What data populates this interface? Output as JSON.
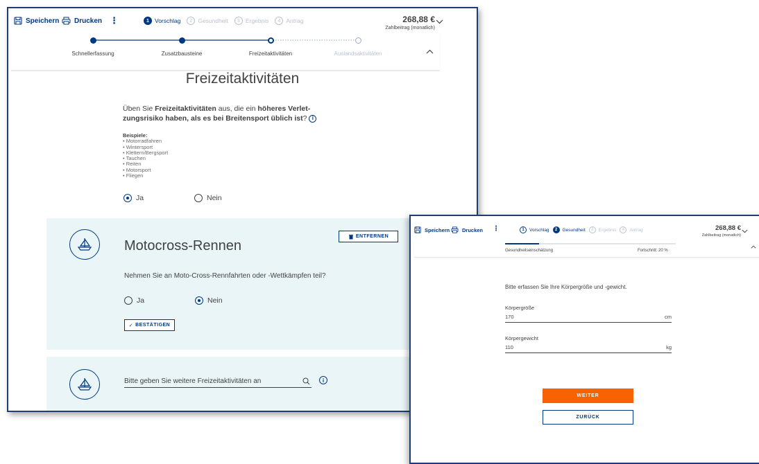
{
  "window1": {
    "toolbar": {
      "save_label": "Speichern",
      "print_label": "Drucken",
      "more_label": "⋮"
    },
    "stepnav": [
      {
        "num": "1",
        "label": "Vorschlag",
        "state": "active"
      },
      {
        "num": "2",
        "label": "Gesundheit",
        "state": "inactive"
      },
      {
        "num": "3",
        "label": "Ergebnis",
        "state": "inactive"
      },
      {
        "num": "4",
        "label": "Antrag",
        "state": "inactive"
      }
    ],
    "price": {
      "amount": "268,88 €",
      "caption": "Zahlbeitrag (monatlich)"
    },
    "progress_steps": [
      "Schnellerfassung",
      "Zusatzbausteine",
      "Freizeitaktivitäten",
      "Auslandsaktivitäten"
    ],
    "heading": "Freizeitaktivitäten",
    "question": {
      "p1": "Üben Sie ",
      "b1": "Freizeitaktivitäten",
      "p2": " aus, die ein ",
      "b2": "höheres Verlet-zungsrisiko haben, als es bei Breitensport üblich ist",
      "p3": "?"
    },
    "examples_title": "Beispiele",
    "examples": [
      "Motorradfahren",
      "Wintersport",
      "Klettern/Bergsport",
      "Tauchen",
      "Reiten",
      "Motorsport",
      "Fliegen"
    ],
    "answer_yes": "Ja",
    "answer_no": "Nein",
    "activity_panel": {
      "title": "Motocross-Rennen",
      "remove_label": "ENTFERNEN",
      "question": "Nehmen Sie an Moto-Cross-Rennfahrten oder -Wettkämpfen teil?",
      "yes": "Ja",
      "no": "Nein",
      "confirm_label": "BESTÄTIGEN"
    },
    "search_panel": {
      "placeholder": "Bitte geben Sie weitere Freizeitaktivitäten an"
    }
  },
  "window2": {
    "toolbar": {
      "save_label": "Speichern",
      "print_label": "Drucken",
      "more_label": "⋮"
    },
    "stepnav": [
      {
        "num": "1",
        "label": "Vorschlag",
        "state": "done"
      },
      {
        "num": "2",
        "label": "Gesundheit",
        "state": "active"
      },
      {
        "num": "3",
        "label": "Ergebnis",
        "state": "inactive"
      },
      {
        "num": "4",
        "label": "Antrag",
        "state": "inactive"
      }
    ],
    "price": {
      "amount": "268,88 €",
      "caption": "Zahlbeitrag (monatlich)"
    },
    "progress": {
      "label": "Gesundheitseinschätzung",
      "status": "Fortschritt: 20 %",
      "value": 0.2
    },
    "instruction": "Bitte erfassen Sie Ihre Körpergröße und -gewicht.",
    "height": {
      "label": "Körpergröße",
      "value": "170",
      "unit": "cm"
    },
    "weight": {
      "label": "Körpergewicht",
      "value": "110",
      "unit": "kg"
    },
    "next_label": "WEITER",
    "back_label": "ZURÜCK"
  },
  "colors": {
    "brand_blue": "#003781",
    "accent_orange": "#f86200",
    "panel_bg": "#eaf5f7"
  }
}
